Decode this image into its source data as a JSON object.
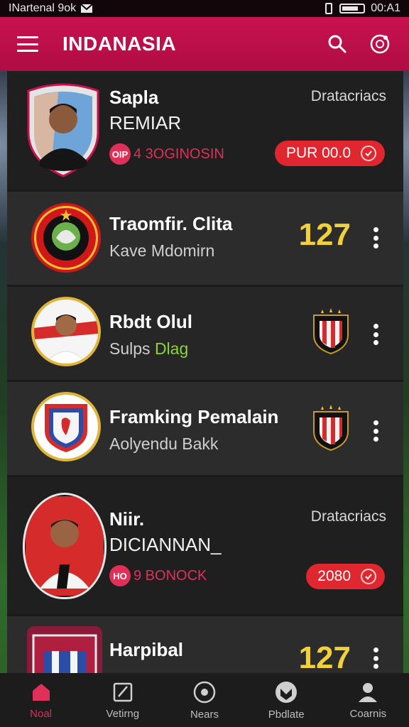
{
  "status": {
    "left_text": "INartenal 9ok",
    "time": "00:A1"
  },
  "header": {
    "title": "INDANASIA"
  },
  "cards": [
    {
      "title": "Sapla",
      "subtitle": "REMIAR",
      "tag": "4 3OGINOSIN",
      "tag_badge": "OIP",
      "right_label": "Dratacriacs",
      "price": "PUR 00.0"
    },
    {
      "title": "Traomfir. Clita",
      "subtitle": "Kave Mdomirn",
      "score": "127"
    },
    {
      "title": "Rbdt Olul",
      "subtitle_a": "Sulps",
      "subtitle_b": "Dlag"
    },
    {
      "title": "Framking Pemalain",
      "subtitle": "Aolyendu Bakk"
    },
    {
      "title": "Niir.",
      "subtitle": "DICIANNAN_",
      "tag": "9 BONOCK",
      "tag_badge": "HO",
      "right_label": "Dratacriacs",
      "price": "2080"
    },
    {
      "title": "Harpibal",
      "score": "127"
    }
  ],
  "nav": [
    {
      "label": "Noal",
      "icon": "home-icon"
    },
    {
      "label": "Vetirng",
      "icon": "edit-icon"
    },
    {
      "label": "Nears",
      "icon": "record-icon"
    },
    {
      "label": "Pbdlate",
      "icon": "shield-check-icon"
    },
    {
      "label": "Coarnis",
      "icon": "person-icon"
    }
  ],
  "colors": {
    "accent": "#c8124f",
    "score": "#f1d03a",
    "price": "#e0262e",
    "subtitle_green": "#8bd43a"
  }
}
